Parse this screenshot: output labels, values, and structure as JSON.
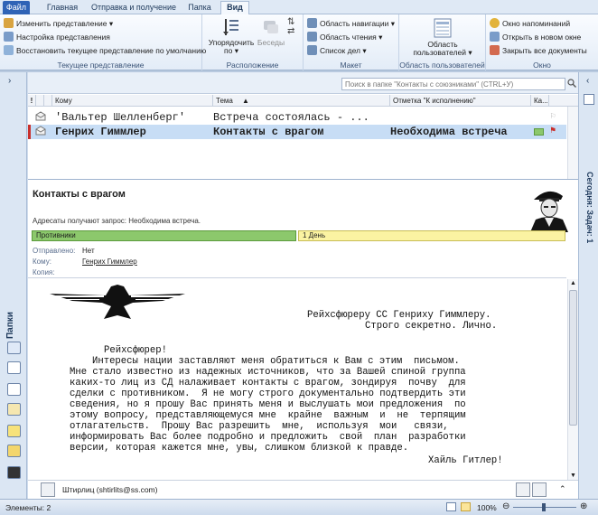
{
  "ribbon_tabs": [
    {
      "label": "Файл"
    },
    {
      "label": "Главная"
    },
    {
      "label": "Отправка и получение"
    },
    {
      "label": "Папка"
    },
    {
      "label": "Вид"
    }
  ],
  "ribbon": {
    "current_view": {
      "change_view": "Изменить представление",
      "view_settings": "Настройка представления",
      "reset_view": "Восстановить текущее представление по умолчанию",
      "title": "Текущее представление"
    },
    "arrangement": {
      "arrange_by": "Упорядочить по",
      "conversations": "Беседы",
      "title": "Расположение"
    },
    "layout": {
      "nav_pane": "Область навигации",
      "reading_pane": "Область чтения",
      "todo_bar": "Список дел",
      "title": "Макет"
    },
    "people_pane": {
      "button": "Область пользователей",
      "title": "Область пользователей"
    },
    "window": {
      "reminders": "Окно напоминаний",
      "open_new": "Открыть в новом окне",
      "close_all": "Закрыть все документы",
      "title": "Окно"
    }
  },
  "left_bar": {
    "folders_label": "Папки"
  },
  "right_bar": {
    "todo_label": "Сегодня: Задач: 1"
  },
  "search": {
    "placeholder": "Поиск в папке \"Контакты с союзниками\" (CTRL+У)"
  },
  "columns": {
    "to": "Кому",
    "subject": "Тема",
    "flag": "Отметка \"К исполнению\"",
    "category": "Ка..."
  },
  "messages": [
    {
      "to": "'Вальтер Шелленберг'",
      "subject": "Встреча состоялась - ...",
      "flag": ""
    },
    {
      "to": "Генрих Гиммлер",
      "subject": "Контакты с врагом",
      "flag": "Необходима встреча"
    }
  ],
  "reading_pane": {
    "subject": "Контакты с врагом",
    "request_note": "Адресаты получают запрос: Необходима встреча.",
    "category": "Противники",
    "flag": "1 День",
    "sent_label": "Отправлено:",
    "sent_value": "Нет",
    "to_label": "Кому:",
    "to_value": "Генрих Гиммлер",
    "cc_label": "Копия:",
    "body": {
      "line1": "Рейхсфюреру СС Генриху Гиммлеру.",
      "line2": "Строго секретно. Лично.",
      "line3": "Рейхсфюрер!",
      "line4": "Интересы нации заставляют меня обратиться к Вам с этим  письмом.",
      "line5": "Мне стало известно из надежных источников, что за Вашей спиной группа",
      "line6": "каких-то лиц из СД налаживает контакты с врагом, зондируя  почву  для",
      "line7": "сделки с противником.  Я не могу строго документально подтвердить эти",
      "line8": "сведения, но я прошу Вас принять меня и выслушать мои предложения  по",
      "line9": "этому вопросу, представляющемуся мне  крайне  важным  и  не  терпящим",
      "line10": "отлагательств.  Прошу Вас разрешить  мне,  используя  мои   связи,",
      "line11": "информировать Вас более подробно и предложить  свой  план  разработки",
      "line12": "версии, которая кажется мне, увы, слишком близкой к правде.",
      "line13": "Хайль Гитлер!"
    },
    "sender": "Штирлиц (shtirlits@ss.com)"
  },
  "status": {
    "items": "Элементы: 2",
    "zoom": "100%"
  },
  "colors": {
    "accent": "#2f63b6",
    "selection": "#c7ddf5",
    "category": "#8cc86c",
    "flag_bar": "#fbf3a2"
  }
}
